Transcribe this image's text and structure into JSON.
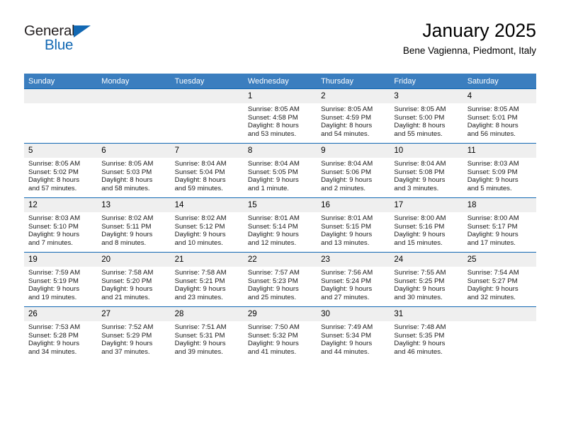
{
  "brand": {
    "name_top": "General",
    "name_bottom": "Blue",
    "color_dark": "#231f20",
    "color_blue": "#1268b3"
  },
  "header": {
    "title": "January 2025",
    "subtitle": "Bene Vagienna, Piedmont, Italy"
  },
  "theme": {
    "header_row_bg": "#3b7ebf",
    "header_row_text": "#ffffff",
    "daynum_bg": "#efefef",
    "cell_border": "#1268b3",
    "cell_bg": "#ffffff"
  },
  "weekdays": [
    "Sunday",
    "Monday",
    "Tuesday",
    "Wednesday",
    "Thursday",
    "Friday",
    "Saturday"
  ],
  "weeks": [
    [
      {
        "day": "",
        "lines": []
      },
      {
        "day": "",
        "lines": []
      },
      {
        "day": "",
        "lines": []
      },
      {
        "day": "1",
        "lines": [
          "Sunrise: 8:05 AM",
          "Sunset: 4:58 PM",
          "Daylight: 8 hours",
          "and 53 minutes."
        ]
      },
      {
        "day": "2",
        "lines": [
          "Sunrise: 8:05 AM",
          "Sunset: 4:59 PM",
          "Daylight: 8 hours",
          "and 54 minutes."
        ]
      },
      {
        "day": "3",
        "lines": [
          "Sunrise: 8:05 AM",
          "Sunset: 5:00 PM",
          "Daylight: 8 hours",
          "and 55 minutes."
        ]
      },
      {
        "day": "4",
        "lines": [
          "Sunrise: 8:05 AM",
          "Sunset: 5:01 PM",
          "Daylight: 8 hours",
          "and 56 minutes."
        ]
      }
    ],
    [
      {
        "day": "5",
        "lines": [
          "Sunrise: 8:05 AM",
          "Sunset: 5:02 PM",
          "Daylight: 8 hours",
          "and 57 minutes."
        ]
      },
      {
        "day": "6",
        "lines": [
          "Sunrise: 8:05 AM",
          "Sunset: 5:03 PM",
          "Daylight: 8 hours",
          "and 58 minutes."
        ]
      },
      {
        "day": "7",
        "lines": [
          "Sunrise: 8:04 AM",
          "Sunset: 5:04 PM",
          "Daylight: 8 hours",
          "and 59 minutes."
        ]
      },
      {
        "day": "8",
        "lines": [
          "Sunrise: 8:04 AM",
          "Sunset: 5:05 PM",
          "Daylight: 9 hours",
          "and 1 minute."
        ]
      },
      {
        "day": "9",
        "lines": [
          "Sunrise: 8:04 AM",
          "Sunset: 5:06 PM",
          "Daylight: 9 hours",
          "and 2 minutes."
        ]
      },
      {
        "day": "10",
        "lines": [
          "Sunrise: 8:04 AM",
          "Sunset: 5:08 PM",
          "Daylight: 9 hours",
          "and 3 minutes."
        ]
      },
      {
        "day": "11",
        "lines": [
          "Sunrise: 8:03 AM",
          "Sunset: 5:09 PM",
          "Daylight: 9 hours",
          "and 5 minutes."
        ]
      }
    ],
    [
      {
        "day": "12",
        "lines": [
          "Sunrise: 8:03 AM",
          "Sunset: 5:10 PM",
          "Daylight: 9 hours",
          "and 7 minutes."
        ]
      },
      {
        "day": "13",
        "lines": [
          "Sunrise: 8:02 AM",
          "Sunset: 5:11 PM",
          "Daylight: 9 hours",
          "and 8 minutes."
        ]
      },
      {
        "day": "14",
        "lines": [
          "Sunrise: 8:02 AM",
          "Sunset: 5:12 PM",
          "Daylight: 9 hours",
          "and 10 minutes."
        ]
      },
      {
        "day": "15",
        "lines": [
          "Sunrise: 8:01 AM",
          "Sunset: 5:14 PM",
          "Daylight: 9 hours",
          "and 12 minutes."
        ]
      },
      {
        "day": "16",
        "lines": [
          "Sunrise: 8:01 AM",
          "Sunset: 5:15 PM",
          "Daylight: 9 hours",
          "and 13 minutes."
        ]
      },
      {
        "day": "17",
        "lines": [
          "Sunrise: 8:00 AM",
          "Sunset: 5:16 PM",
          "Daylight: 9 hours",
          "and 15 minutes."
        ]
      },
      {
        "day": "18",
        "lines": [
          "Sunrise: 8:00 AM",
          "Sunset: 5:17 PM",
          "Daylight: 9 hours",
          "and 17 minutes."
        ]
      }
    ],
    [
      {
        "day": "19",
        "lines": [
          "Sunrise: 7:59 AM",
          "Sunset: 5:19 PM",
          "Daylight: 9 hours",
          "and 19 minutes."
        ]
      },
      {
        "day": "20",
        "lines": [
          "Sunrise: 7:58 AM",
          "Sunset: 5:20 PM",
          "Daylight: 9 hours",
          "and 21 minutes."
        ]
      },
      {
        "day": "21",
        "lines": [
          "Sunrise: 7:58 AM",
          "Sunset: 5:21 PM",
          "Daylight: 9 hours",
          "and 23 minutes."
        ]
      },
      {
        "day": "22",
        "lines": [
          "Sunrise: 7:57 AM",
          "Sunset: 5:23 PM",
          "Daylight: 9 hours",
          "and 25 minutes."
        ]
      },
      {
        "day": "23",
        "lines": [
          "Sunrise: 7:56 AM",
          "Sunset: 5:24 PM",
          "Daylight: 9 hours",
          "and 27 minutes."
        ]
      },
      {
        "day": "24",
        "lines": [
          "Sunrise: 7:55 AM",
          "Sunset: 5:25 PM",
          "Daylight: 9 hours",
          "and 30 minutes."
        ]
      },
      {
        "day": "25",
        "lines": [
          "Sunrise: 7:54 AM",
          "Sunset: 5:27 PM",
          "Daylight: 9 hours",
          "and 32 minutes."
        ]
      }
    ],
    [
      {
        "day": "26",
        "lines": [
          "Sunrise: 7:53 AM",
          "Sunset: 5:28 PM",
          "Daylight: 9 hours",
          "and 34 minutes."
        ]
      },
      {
        "day": "27",
        "lines": [
          "Sunrise: 7:52 AM",
          "Sunset: 5:29 PM",
          "Daylight: 9 hours",
          "and 37 minutes."
        ]
      },
      {
        "day": "28",
        "lines": [
          "Sunrise: 7:51 AM",
          "Sunset: 5:31 PM",
          "Daylight: 9 hours",
          "and 39 minutes."
        ]
      },
      {
        "day": "29",
        "lines": [
          "Sunrise: 7:50 AM",
          "Sunset: 5:32 PM",
          "Daylight: 9 hours",
          "and 41 minutes."
        ]
      },
      {
        "day": "30",
        "lines": [
          "Sunrise: 7:49 AM",
          "Sunset: 5:34 PM",
          "Daylight: 9 hours",
          "and 44 minutes."
        ]
      },
      {
        "day": "31",
        "lines": [
          "Sunrise: 7:48 AM",
          "Sunset: 5:35 PM",
          "Daylight: 9 hours",
          "and 46 minutes."
        ]
      },
      {
        "day": "",
        "lines": []
      }
    ]
  ]
}
